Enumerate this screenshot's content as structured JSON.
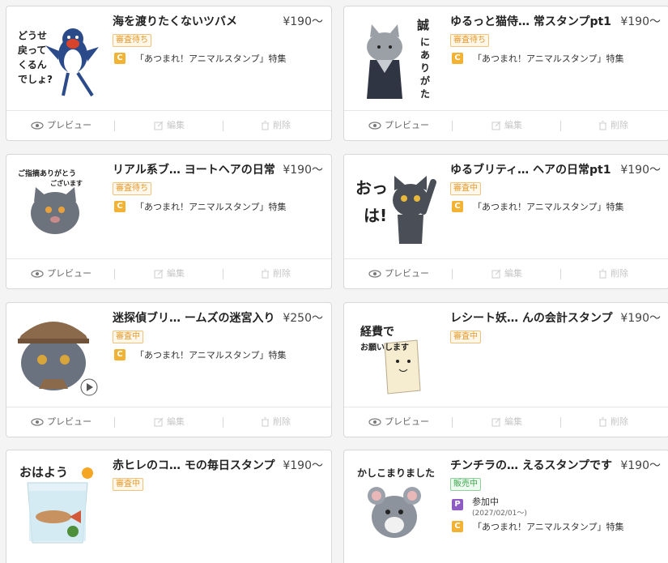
{
  "cards": [
    {
      "title": "海を渡りたくないツバメ",
      "price": "¥190〜",
      "badge": "審査待ち",
      "feature": "「あつまれ！アニマルスタンプ」特集",
      "art_text": "どうせ\n戻って\nくるん\nでしょ?"
    },
    {
      "title": "ゆるっと猫侍… 常スタンプpt1",
      "price": "¥190〜",
      "badge": "審査待ち",
      "feature": "「あつまれ！アニマルスタンプ」特集",
      "art_text": "誠にありがたき"
    },
    {
      "title": "リアル系ブ… ヨートヘアの日常",
      "price": "¥190〜",
      "badge": "審査待ち",
      "feature": "「あつまれ！アニマルスタンプ」特集",
      "art_text": "ご指摘ありがとうございます"
    },
    {
      "title": "ゆるブリティ… ヘアの日常pt1",
      "price": "¥190〜",
      "badge": "審査中",
      "feature": "「あつまれ！アニマルスタンプ」特集",
      "art_text": "おっは!"
    },
    {
      "title": "迷探偵ブリ… ームズの迷宮入り",
      "price": "¥250〜",
      "badge": "審査中",
      "feature": "「あつまれ！アニマルスタンプ」特集",
      "art_text": ""
    },
    {
      "title": "レシート妖… んの会計スタンプ",
      "price": "¥190〜",
      "badge": "審査中",
      "feature": "「あつまれ！アニマルスタンプ」特集",
      "art_text": "経費でお願いします"
    },
    {
      "title": "赤ヒレのコ… モの毎日スタンプ",
      "price": "¥190〜",
      "badge": "審査中",
      "feature": "",
      "art_text": "おはよう"
    },
    {
      "title": "チンチラの… えるスタンプです",
      "price": "¥190〜",
      "badge": "販売中",
      "campaign": "参加中",
      "period": "(2027/02/01〜)",
      "feature": "「あつまれ！アニマルスタンプ」特集",
      "art_text": "かしこまりました"
    }
  ],
  "actions": {
    "preview": "プレビュー",
    "edit": "編集",
    "delete": "削除"
  },
  "tags": {
    "c": "C",
    "p": "P"
  },
  "colors": {
    "badge_wait": "#e39a2d",
    "badge_sale": "#3aa64a",
    "tag_c": "#f2b233",
    "tag_p": "#8e5bc3"
  }
}
